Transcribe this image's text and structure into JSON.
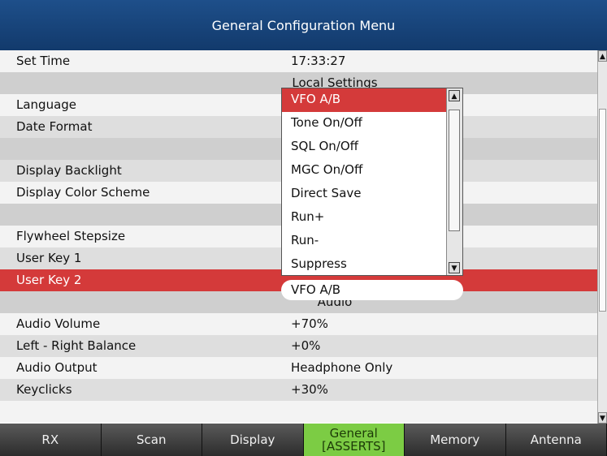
{
  "title": "General Configuration Menu",
  "rows": [
    {
      "label": "Set Time",
      "value": "17:33:27"
    },
    {
      "section": "Local Settings"
    },
    {
      "label": "Language",
      "value": ""
    },
    {
      "label": "Date Format",
      "value": ""
    },
    {
      "section": ""
    },
    {
      "label": "Display Backlight",
      "value": ""
    },
    {
      "label": "Display Color Scheme",
      "value": ""
    },
    {
      "section": ""
    },
    {
      "label": "Flywheel Stepsize",
      "value": ""
    },
    {
      "label": "User Key 1",
      "value": ""
    },
    {
      "label": "User Key 2",
      "value": "",
      "selected": true
    },
    {
      "section": "Audio"
    },
    {
      "label": "Audio Volume",
      "value": "+70%"
    },
    {
      "label": "Left - Right Balance",
      "value": "+0%"
    },
    {
      "label": "Audio Output",
      "value": "Headphone Only"
    },
    {
      "label": "Keyclicks",
      "value": "+30%"
    },
    {
      "label": "",
      "value": ""
    }
  ],
  "edit_value": "VFO A/B",
  "dropdown": {
    "options": [
      "VFO A/B",
      "Tone On/Off",
      "SQL On/Off",
      "MGC On/Off",
      "Direct Save",
      "Run+",
      "Run-",
      "Suppress"
    ],
    "selected_index": 0
  },
  "tabs": [
    {
      "label": "RX"
    },
    {
      "label": "Scan"
    },
    {
      "label": "Display"
    },
    {
      "label": "General",
      "sub": "[ASSERTS]",
      "active": true
    },
    {
      "label": "Memory"
    },
    {
      "label": "Antenna"
    }
  ],
  "colors": {
    "title_bg": "#1e4f8a",
    "selected": "#d43a3a",
    "active_tab": "#7ccc44"
  }
}
